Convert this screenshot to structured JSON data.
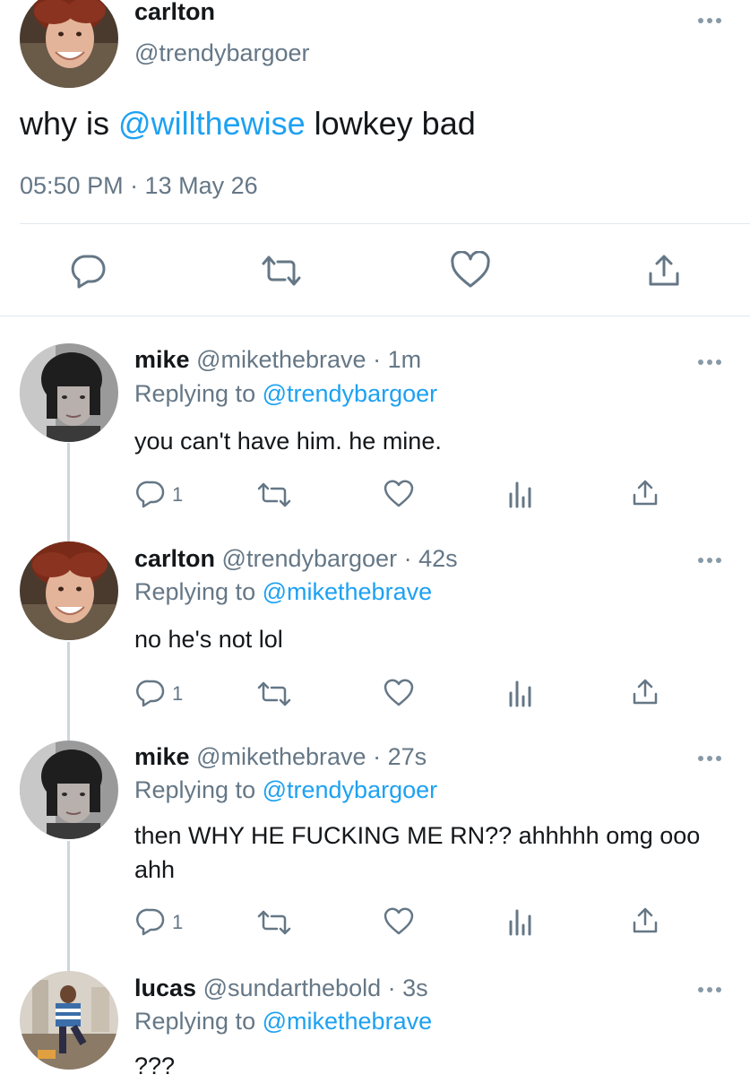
{
  "main_tweet": {
    "display_name": "carlton",
    "handle": "@trendybargoer",
    "text_before": "why is ",
    "mention": "@willthewise",
    "text_after": " lowkey bad",
    "timestamp": "05:50 PM · 13 May 26"
  },
  "replies": [
    {
      "display_name": "mike",
      "handle": "@mikethebrave",
      "time": "· 1m",
      "replying_label": "Replying to",
      "replying_to": "@trendybargoer",
      "text": "you can't have him. he mine.",
      "reply_count": "1"
    },
    {
      "display_name": "carlton",
      "handle": "@trendybargoer",
      "time": "· 42s",
      "replying_label": "Replying to",
      "replying_to": "@mikethebrave",
      "text": "no he's not lol",
      "reply_count": "1"
    },
    {
      "display_name": "mike",
      "handle": "@mikethebrave",
      "time": "· 27s",
      "replying_label": "Replying to",
      "replying_to": "@trendybargoer",
      "text": "then WHY HE FUCKING ME RN?? ahhhhh omg ooo ahh",
      "reply_count": "1"
    },
    {
      "display_name": "lucas",
      "handle": "@sundarthebold",
      "time": "· 3s",
      "replying_label": "Replying to",
      "replying_to": "@mikethebrave",
      "text": "???"
    }
  ],
  "colors": {
    "link": "#1da1f2",
    "muted": "#657786",
    "icon": "#8899a6",
    "thread_line": "#ccd6dd"
  },
  "icons": [
    "reply-icon",
    "retweet-icon",
    "like-icon",
    "analytics-icon",
    "share-icon",
    "more-icon"
  ]
}
